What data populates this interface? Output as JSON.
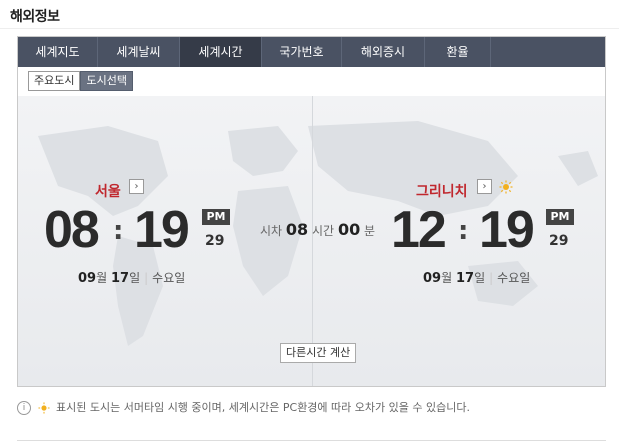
{
  "page": {
    "title": "해외정보"
  },
  "tabs": [
    {
      "label": "세계지도",
      "active": false
    },
    {
      "label": "세계날씨",
      "active": false
    },
    {
      "label": "세계시간",
      "active": true
    },
    {
      "label": "국가번호",
      "active": false
    },
    {
      "label": "해외증시",
      "active": false
    },
    {
      "label": "환율",
      "active": false
    }
  ],
  "subtabs": [
    {
      "label": "주요도시",
      "active": false
    },
    {
      "label": "도시선택",
      "active": true
    }
  ],
  "left_clock": {
    "city": "서울",
    "hour": "08",
    "colon": ":",
    "minute": "19",
    "ampm": "PM",
    "seconds": "29",
    "month": "09",
    "month_unit": "월",
    "day": "17",
    "day_unit": "일",
    "weekday": "수요일"
  },
  "right_clock": {
    "city": "그리니치",
    "hour": "12",
    "colon": ":",
    "minute": "19",
    "ampm": "PM",
    "seconds": "29",
    "month": "09",
    "month_unit": "월",
    "day": "17",
    "day_unit": "일",
    "weekday": "수요일",
    "dst_icon": "sun-icon"
  },
  "time_diff": {
    "prefix": "시차",
    "hours": "08",
    "hours_unit": "시간",
    "minutes": "00",
    "minutes_unit": "분"
  },
  "calc_button": "다른시간 계산",
  "note": {
    "text": "표시된 도시는 서머타임 시행 중이며, 세계시간은 PC환경에 따라 오차가 있을 수 있습니다."
  },
  "colors": {
    "tab_bg": "#4a5263",
    "tab_active": "#353b48",
    "city_red": "#c0272d",
    "sun": "#f2b01e"
  }
}
